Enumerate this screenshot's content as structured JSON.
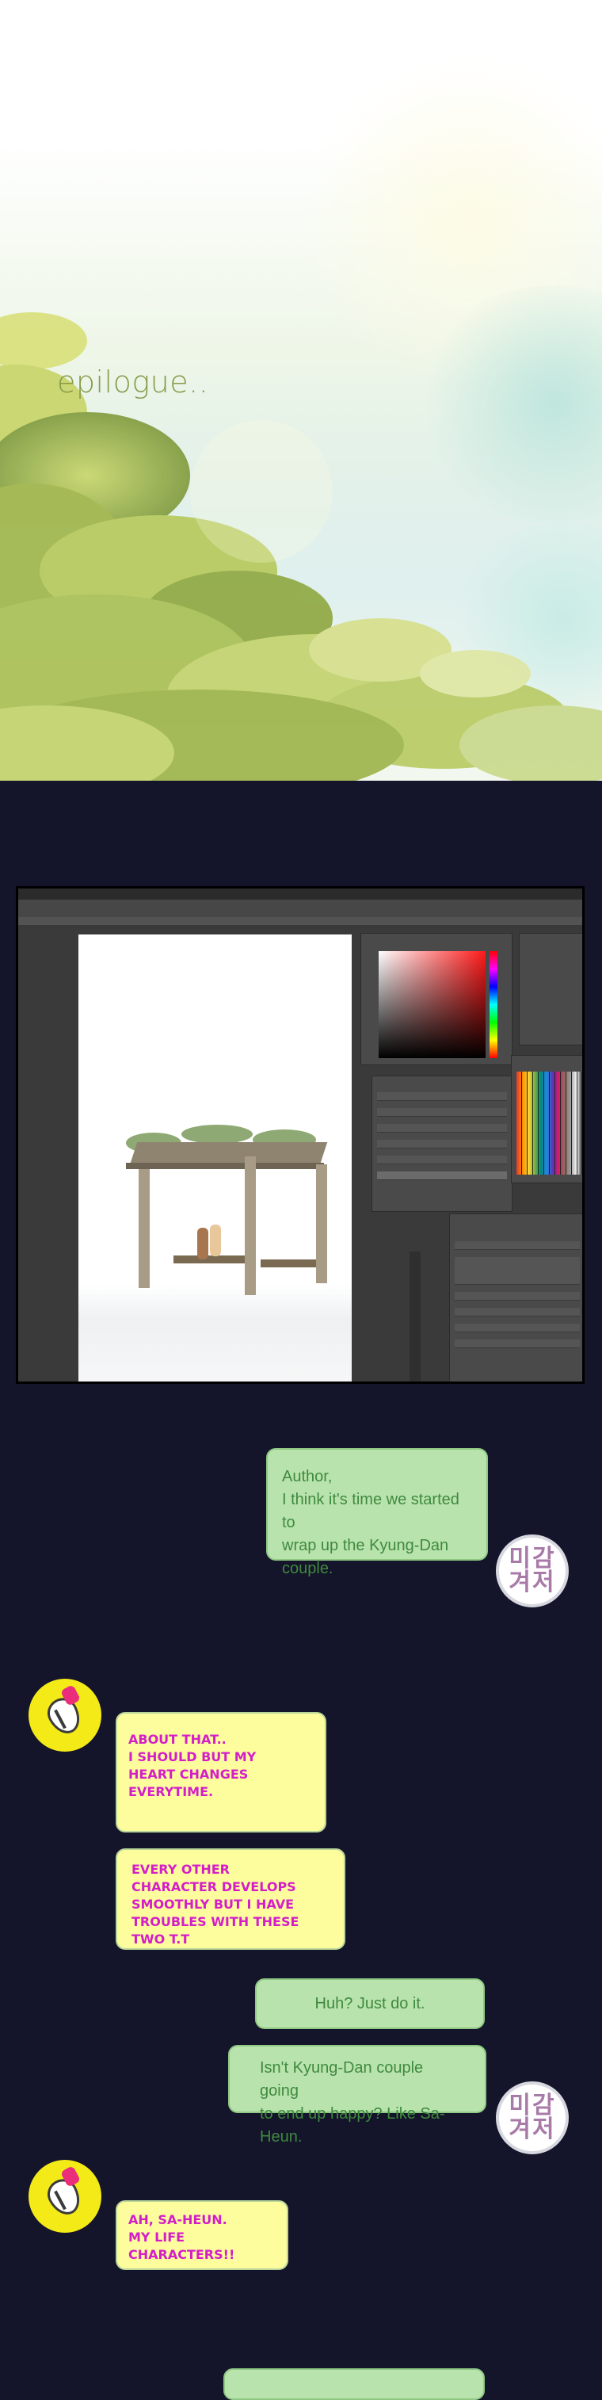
{
  "hero": {
    "title": "epilogue.."
  },
  "conversation": [
    {
      "speaker": "reader",
      "lines": [
        "Author,",
        "I think it's time we started to",
        "wrap up the Kyung-Dan couple."
      ]
    },
    {
      "speaker": "author",
      "lines": [
        "About that..",
        "I should but my",
        "heart changes",
        "everytime."
      ]
    },
    {
      "speaker": "author",
      "lines": [
        "Every other",
        "character develops",
        "smoothly but I have",
        "troubles with these",
        "two T.T"
      ]
    },
    {
      "speaker": "reader",
      "lines": [
        "Huh? Just do it."
      ]
    },
    {
      "speaker": "reader",
      "lines": [
        "Isn't Kyung-Dan couple going",
        "to end up happy? Like Sa-Heun."
      ]
    },
    {
      "speaker": "author",
      "lines": [
        "Ah, Sa-Heun.",
        "My life",
        "characters!!"
      ]
    }
  ],
  "avatars": {
    "reader_label_top": "미감",
    "reader_label_bottom": "겨저"
  },
  "colors": {
    "background": "#14142a",
    "reader_bubble": "#b9e3ad",
    "reader_text": "#3f8a3f",
    "author_bubble": "#fdfd9e",
    "author_text": "#d41ec8",
    "author_icon": "#f4ea18"
  },
  "icons": {
    "author": "pen-nib-icon",
    "reader": "avatar-icon"
  }
}
